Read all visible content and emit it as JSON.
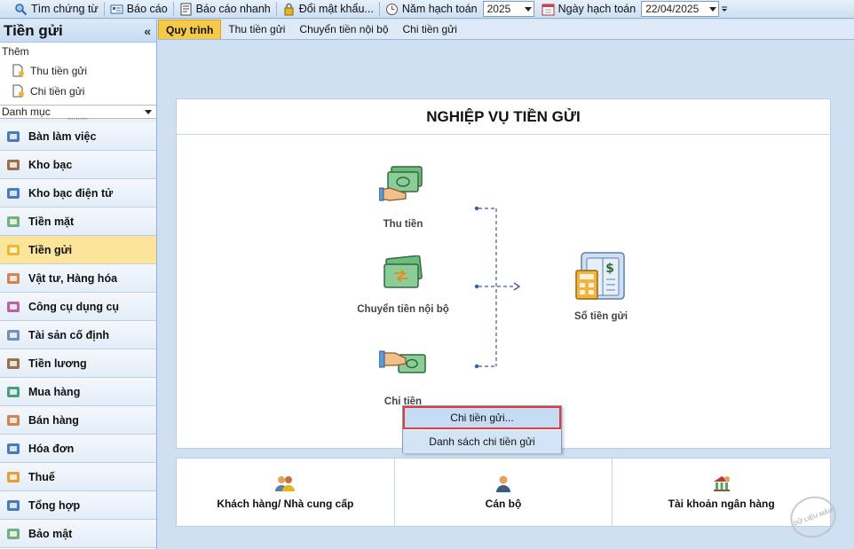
{
  "toolbar": {
    "search_label": "Tìm chứng từ",
    "report_label": "Báo cáo",
    "quick_report_label": "Báo cáo nhanh",
    "change_password_label": "Đổi mật khẩu...",
    "fiscal_year_label": "Năm hạch toán",
    "fiscal_year_value": "2025",
    "posting_date_label": "Ngày hạch toán",
    "posting_date_value": "22/04/2025"
  },
  "left_panel": {
    "title": "Tiền gửi",
    "collapse_glyph": "«",
    "add_label": "Thêm",
    "links": [
      {
        "label": "Thu tiền gửi"
      },
      {
        "label": "Chi tiền gửi"
      }
    ],
    "category_select": "Danh mục",
    "grip": "''''''''''"
  },
  "nav": {
    "items": [
      {
        "label": "Bàn làm việc",
        "icon": "desk-icon"
      },
      {
        "label": "Kho bạc",
        "icon": "treasury-icon"
      },
      {
        "label": "Kho bạc điện tử",
        "icon": "e-treasury-icon"
      },
      {
        "label": "Tiền mặt",
        "icon": "cash-icon"
      },
      {
        "label": "Tiền gửi",
        "icon": "deposit-icon"
      },
      {
        "label": "Vật tư, Hàng hóa",
        "icon": "goods-icon"
      },
      {
        "label": "Công cụ dụng cụ",
        "icon": "tools-icon"
      },
      {
        "label": "Tài sản cố định",
        "icon": "fixed-asset-icon"
      },
      {
        "label": "Tiền lương",
        "icon": "salary-icon"
      },
      {
        "label": "Mua hàng",
        "icon": "cart-icon"
      },
      {
        "label": "Bán hàng",
        "icon": "sales-icon"
      },
      {
        "label": "Hóa đơn",
        "icon": "invoice-icon"
      },
      {
        "label": "Thuế",
        "icon": "tax-icon"
      },
      {
        "label": "Tổng hợp",
        "icon": "summary-icon"
      },
      {
        "label": "Bảo mật",
        "icon": "shield-icon"
      }
    ],
    "active_index": 4
  },
  "tabs": [
    {
      "label": "Quy trình",
      "active": true
    },
    {
      "label": "Thu tiền gửi",
      "active": false
    },
    {
      "label": "Chuyển tiền nội bộ",
      "active": false
    },
    {
      "label": "Chi tiền gửi",
      "active": false
    }
  ],
  "process": {
    "title": "NGHIỆP VỤ TIỀN GỬI",
    "receive_label": "Thu tiền",
    "transfer_label": "Chuyển tiền nội bộ",
    "pay_label": "Chi tiền",
    "ledger_label": "Sổ tiền gửi"
  },
  "popup": {
    "items": [
      {
        "label": "Chi tiền gửi..."
      },
      {
        "label": "Danh sách chi tiền gửi"
      }
    ]
  },
  "bottom": {
    "items": [
      {
        "label": "Khách hàng/ Nhà cung cấp"
      },
      {
        "label": "Cán bộ"
      },
      {
        "label": "Tài khoản ngân hàng"
      }
    ]
  },
  "watermark": "DỮ LIỆU MẪU",
  "colors": {
    "accent": "#f7c94a",
    "active_nav": "#fde49b",
    "highlight_border": "#e23b3b",
    "money_green": "#5aa469",
    "flow_blue": "#3b5ba9"
  }
}
